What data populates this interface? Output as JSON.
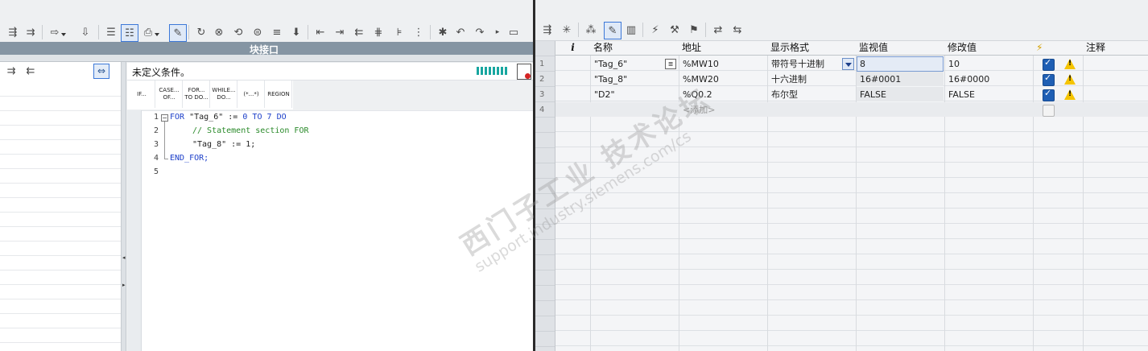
{
  "left_panel": {
    "block_interface_title": "块接口",
    "condition_text": "未定义条件。",
    "palette": [
      "IF...",
      "CASE... OF...",
      "FOR... TO DO...",
      "WHILE... DO...",
      "(*...*)",
      "REGION"
    ]
  },
  "editor": {
    "line_numbers": [
      "1",
      "2",
      "3",
      "4",
      "5"
    ],
    "lines": {
      "l1_kw_for": "FOR",
      "l1_var": "\"Tag_6\"",
      "l1_assign": ":=",
      "l1_zero": "0",
      "l1_to": "TO",
      "l1_seven": "7",
      "l1_do": "DO",
      "l2_comment": "// Statement section FOR",
      "l3_code": "\"Tag_8\" := 1;",
      "l4_end": "END_FOR;"
    }
  },
  "watch_table": {
    "headers": {
      "info": "i",
      "name": "名称",
      "address": "地址",
      "format": "显示格式",
      "monitor": "监视值",
      "modify": "修改值",
      "flag": "⚡",
      "comment": "注释"
    },
    "rows": [
      {
        "num": "1",
        "name": "\"Tag_6\"",
        "address": "%MW10",
        "format": "带符号十进制",
        "monitor": "8",
        "modify": "10"
      },
      {
        "num": "2",
        "name": "\"Tag_8\"",
        "address": "%MW20",
        "format": "十六进制",
        "monitor": "16#0001",
        "modify": "16#0000"
      },
      {
        "num": "3",
        "name": "\"D2\"",
        "address": "%Q0.2",
        "format": "布尔型",
        "monitor": "FALSE",
        "modify": "FALSE"
      }
    ],
    "add_row": {
      "num": "4",
      "placeholder": "<添加>"
    }
  },
  "watermark": {
    "line1": "西门子工业 技术论坛",
    "line2": "support.industry.siemens.com/cs"
  },
  "colors": {
    "accent": "#3c78d8",
    "header_bar": "#7f8f9e",
    "keyword": "#1c3fc9",
    "comment": "#2a8a2a"
  }
}
